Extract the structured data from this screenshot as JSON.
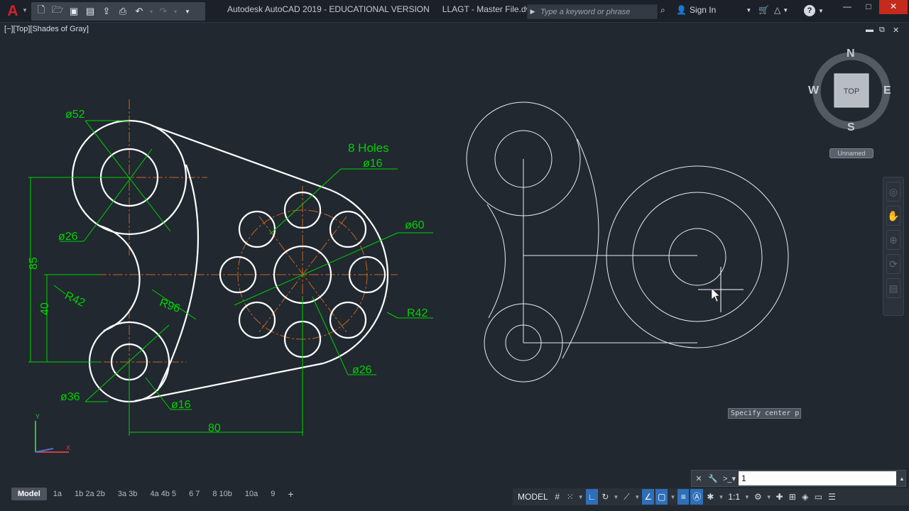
{
  "titlebar": {
    "app_logo": "A",
    "title": "Autodesk AutoCAD 2019 - EDUCATIONAL VERSION",
    "file": "LLAGT - Master File.dwg",
    "search_placeholder": "Type a keyword or phrase",
    "sign_in": "Sign In",
    "qat_icons": [
      "new-icon",
      "open-icon",
      "save-icon",
      "saveas-icon",
      "open-web-icon",
      "plot-icon",
      "undo-icon",
      "redo-icon"
    ]
  },
  "viewport": {
    "label": "[−][Top][Shades of Gray]",
    "viewcube": {
      "top": "TOP",
      "north": "N",
      "south": "S",
      "east": "E",
      "west": "W",
      "ucs": "Unnamed"
    }
  },
  "drawing": {
    "dims": {
      "d52": "ø52",
      "d26_left": "ø26",
      "holes_title": "8 Holes",
      "holes_dia": "ø16",
      "d60": "ø60",
      "r42_right": "R42",
      "d26_bottom": "ø26",
      "d36": "ø36",
      "d16_bottom": "ø16",
      "len80": "80",
      "len85": "85",
      "len40": "40",
      "r42_left": "R42",
      "r96": "R96"
    },
    "colors": {
      "dim": "#00d200",
      "center": "#c8641e",
      "geometry": "#ffffff",
      "background": "#212830"
    }
  },
  "tooltip": {
    "text": "Specify center p"
  },
  "cmdline": {
    "value": "1"
  },
  "layout_tabs": [
    "Model",
    "1a",
    "1b 2a 2b",
    "3a 3b",
    "4a 4b 5",
    "6 7",
    "8 10b",
    "10a",
    "9",
    "+"
  ],
  "status": {
    "model": "MODEL",
    "scale": "1:1"
  },
  "window": {
    "minimize": "—",
    "maximize": "□",
    "close": "✕"
  }
}
